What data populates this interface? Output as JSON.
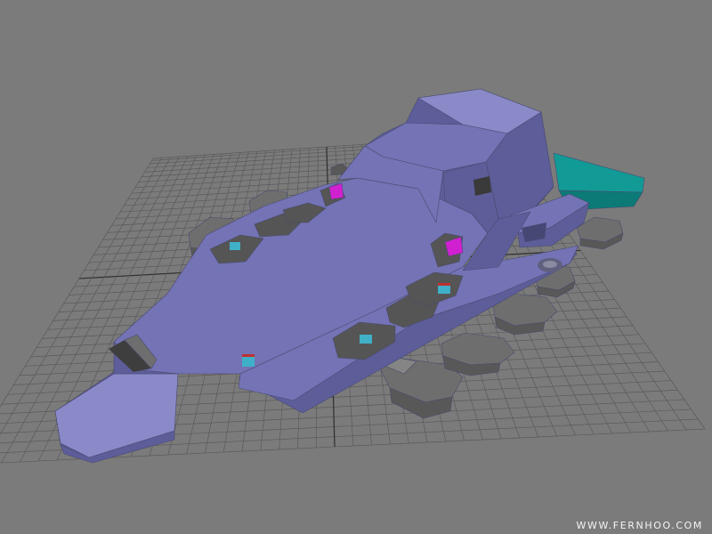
{
  "viewport": {
    "background": "#7b7b7b",
    "grid_line_color": "#5a5a5a",
    "grid_axis_color": "#2e2e2e",
    "show_grid": true
  },
  "model": {
    "hull_color": "#7373b5",
    "hull_shadow_color": "#5d5d9a",
    "hull_highlight_color": "#8a8ac9",
    "panel_color": "#555555",
    "landing_gear_color": "#6e6e6e",
    "engine_color": "#119a96",
    "highlight_color": "#d020d0"
  },
  "watermark": {
    "text": "WWW.FERNHOO.COM"
  }
}
